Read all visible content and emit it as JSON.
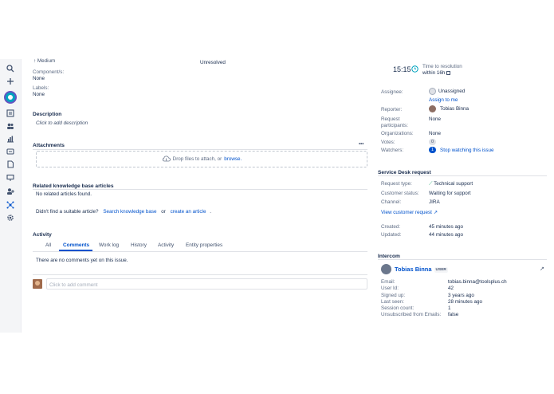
{
  "left": {
    "status_prev_fragment": "Medium",
    "resolution_value": "Unresolved",
    "components_label": "Component/s:",
    "components_value": "None",
    "labels_label": "Labels:",
    "labels_value": "None",
    "description_heading": "Description",
    "description_placeholder": "Click to add description",
    "attachments_heading": "Attachments",
    "attachments_more": "•••",
    "drop_text": "Drop files to attach, or",
    "browse_link": "browse.",
    "related_heading": "Related knowledge base articles",
    "related_empty": "No related articles found.",
    "suitable_question": "Didn't find a suitable article?",
    "search_kb_link": "Search knowledge base",
    "or_text": "or",
    "create_article_link": "create an article",
    "trailing_dot": ".",
    "activity_heading": "Activity",
    "tabs": [
      "All",
      "Comments",
      "Work log",
      "History",
      "Activity",
      "Entity properties"
    ],
    "no_comments": "There are no comments yet on this issue.",
    "comment_placeholder": "Click to add comment"
  },
  "right": {
    "time_value": "15:15",
    "time_to_resolution_label": "Time to resolution",
    "within_label": "within 16h",
    "assignee_label": "Assignee:",
    "assignee_value": "Unassigned",
    "assign_to_me": "Assign to me",
    "reporter_label": "Reporter:",
    "reporter_value": "Tobias Binna",
    "request_participants_label_1": "Request",
    "request_participants_label_2": "participants:",
    "request_participants_value": "None",
    "organizations_label": "Organizations:",
    "organizations_value": "None",
    "votes_label": "Votes:",
    "votes_value": "0",
    "watchers_label": "Watchers:",
    "watchers_value": "1",
    "stop_watching": "Stop watching this issue",
    "sd_heading": "Service Desk request",
    "request_type_label": "Request type:",
    "request_type_value": "Technical support",
    "customer_status_label": "Customer status:",
    "customer_status_value": "Waiting for support",
    "channel_label": "Channel:",
    "channel_value": "JIRA",
    "view_customer_request": "View customer request",
    "created_label": "Created:",
    "created_value": "45 minutes ago",
    "updated_label": "Updated:",
    "updated_value": "44 minutes ago",
    "intercom_heading": "Intercom",
    "intercom_user_name": "Tobias Binna",
    "intercom_user_tag": "USER",
    "email_label": "Email:",
    "email_value": "tobias.binna@toolsplus.ch",
    "userid_label": "User Id:",
    "userid_value": "42",
    "signedup_label": "Signed up:",
    "signedup_value": "3 years ago",
    "lastseen_label": "Last seen:",
    "lastseen_value": "28 minutes ago",
    "sessions_label": "Session count:",
    "sessions_value": "1",
    "unsub_label": "Unsubscribed from Emails:",
    "unsub_value": "false"
  },
  "colors": {
    "link": "#0052cc",
    "nav_bg": "#f4f5f7",
    "text": "#172b4d",
    "muted": "#5e6c84"
  }
}
